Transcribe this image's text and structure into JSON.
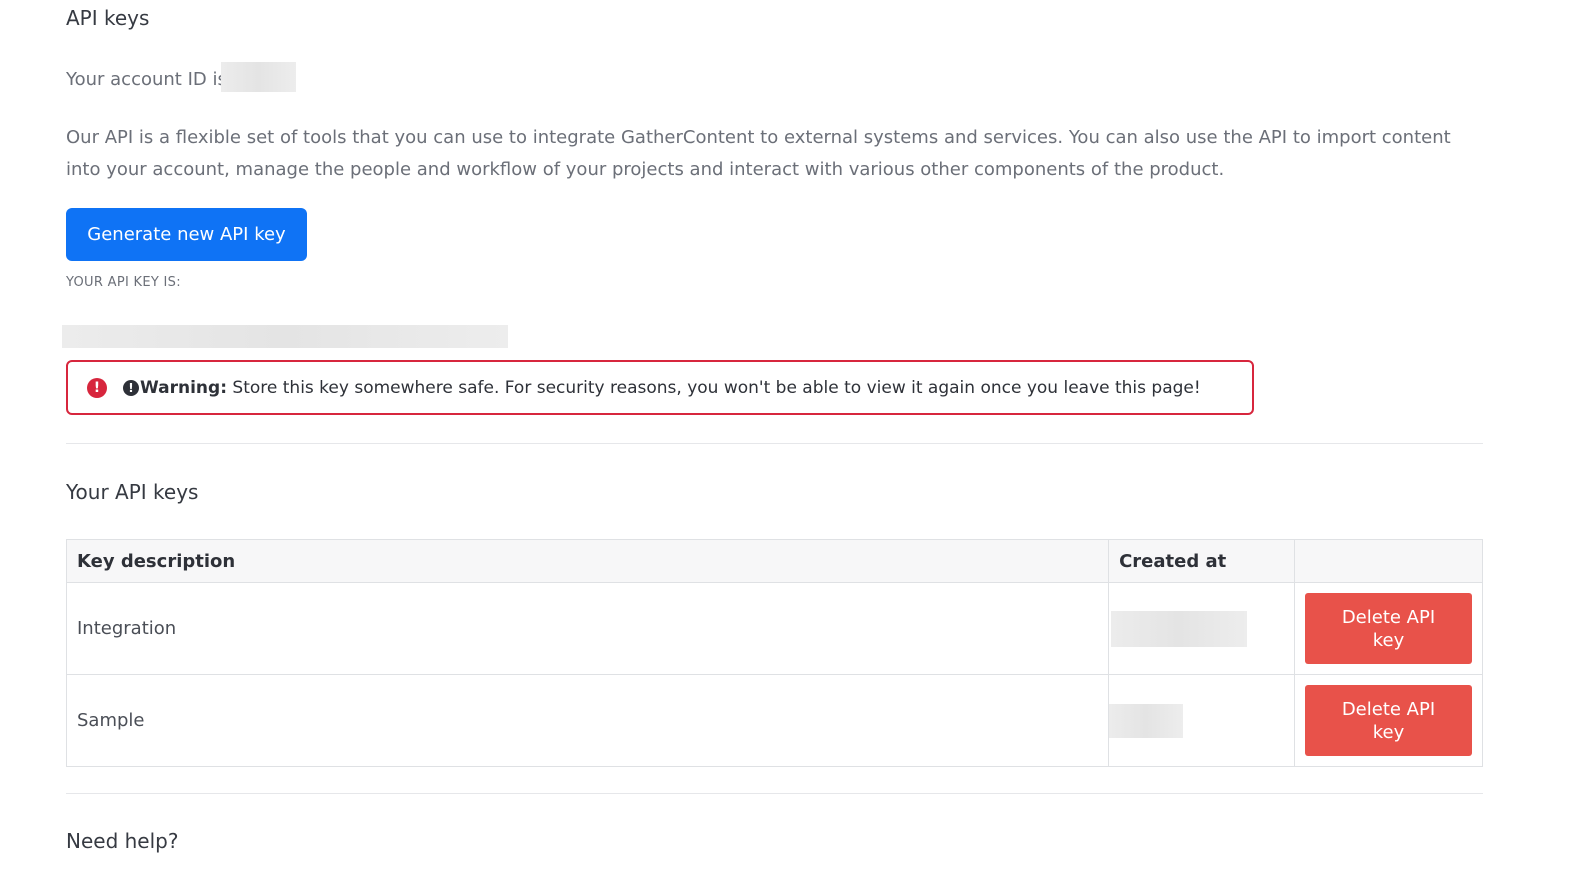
{
  "page": {
    "title": "API keys"
  },
  "account": {
    "label": "Your account ID is"
  },
  "intro": "Our API is a flexible set of tools that you can use to integrate GatherContent to external systems and services. You can also use the API to import content into your account, manage the people and workflow of your projects and interact with various other components of the product.",
  "generate_button": "Generate new API key",
  "key_label": "YOUR API KEY IS:",
  "warning": {
    "strong": "Warning:",
    "text": " Store this key somewhere safe. For security reasons, you won't be able to view it again once you leave this page!"
  },
  "your_keys": {
    "title": "Your API keys",
    "columns": [
      "Key description",
      "Created at",
      ""
    ],
    "rows": [
      {
        "description": "Integration",
        "action": "Delete API key"
      },
      {
        "description": "Sample",
        "action": "Delete API key"
      }
    ]
  },
  "help": {
    "title": "Need help?"
  },
  "colors": {
    "primary": "#0f73f5",
    "danger": "#e8524a",
    "warning_border": "#d7263d"
  },
  "icons": {
    "warning": "exclamation-circle-icon"
  }
}
